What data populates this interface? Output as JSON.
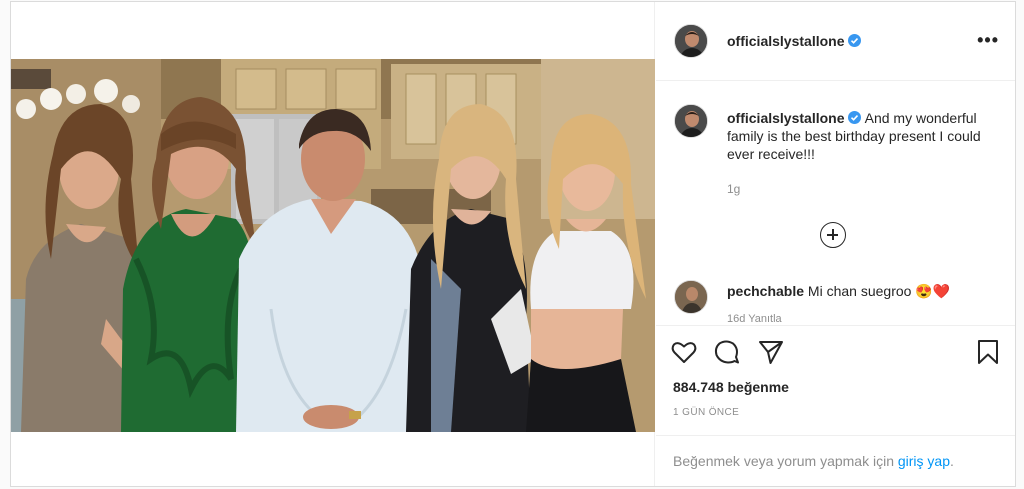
{
  "post": {
    "username": "officialslystallone",
    "caption_text": "And my wonderful family is the best birthday present I could ever receive!!!",
    "caption_time": "1g",
    "comments": [
      {
        "username": "pechchable",
        "text": "Mi chan suegroo 😍❤️",
        "meta": "16d   Yanıtla"
      }
    ],
    "likes": "884.748 beğenme",
    "posted": "1 GÜN ÖNCE",
    "more_label": "•••"
  },
  "login": {
    "prefix": "Beğenmek veya yorum yapmak için ",
    "link": "giriş yap",
    "suffix": "."
  },
  "icons": {
    "heart": "heart-icon",
    "comment": "comment-icon",
    "share": "share-icon",
    "bookmark": "bookmark-icon",
    "verified": "verified-icon",
    "load_more": "plus-circle-icon"
  },
  "colors": {
    "link": "#0095f6",
    "verified": "#3897f0",
    "border": "#dbdbdb",
    "muted": "#8e8e8e"
  }
}
